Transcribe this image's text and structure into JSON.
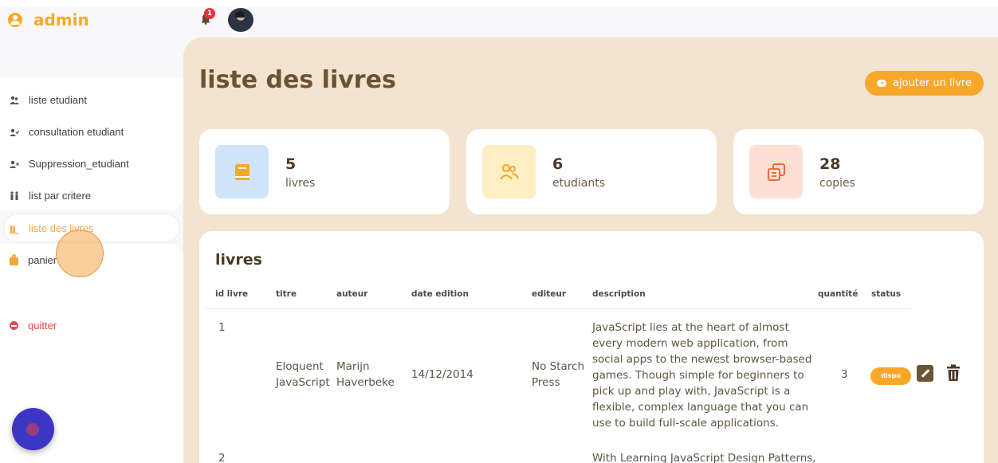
{
  "brand": {
    "title": "admin"
  },
  "topbar": {
    "notification_count": "1"
  },
  "sidebar": {
    "items": [
      {
        "label": "liste etudiant",
        "icon": "user-group-icon"
      },
      {
        "label": "consultation etudiant",
        "icon": "user-check-icon"
      },
      {
        "label": "Suppression_etudiant",
        "icon": "user-remove-icon"
      },
      {
        "label": "list par critere",
        "icon": "people-icon"
      },
      {
        "label": "liste des livres",
        "icon": "books-icon",
        "active": true
      },
      {
        "label": "panier",
        "icon": "bag-icon"
      },
      {
        "label": "quitter",
        "icon": "quit-icon"
      }
    ]
  },
  "main": {
    "title": "liste des livres",
    "add_button": "ajouter un livre",
    "stats": [
      {
        "value": "5",
        "label": "livres",
        "color": "#cfe4f8",
        "icon_color": "#f7a82a"
      },
      {
        "value": "6",
        "label": "etudiants",
        "color": "#fdefc2",
        "icon_color": "#f7a82a"
      },
      {
        "value": "28",
        "label": "copies",
        "color": "#fde0d4",
        "icon_color": "#ef6a3a"
      }
    ],
    "table": {
      "title": "livres",
      "headers": [
        "id livre",
        "titre",
        "auteur",
        "date edition",
        "editeur",
        "description",
        "quantité",
        "status"
      ],
      "rows": [
        {
          "id": "1",
          "titre": "Eloquent JavaScript",
          "auteur": "Marijn Haverbeke",
          "date": "14/12/2014",
          "editeur": "No Starch Press",
          "description": "JavaScript lies at the heart of almost every modern web application, from social apps to the newest browser-based games. Though simple for beginners to pick up and play with, JavaScript is a flexible, complex language that you can use to build full-scale applications.",
          "quantite": "3",
          "status": "dispo"
        },
        {
          "id": "2",
          "description": "With Learning JavaScript Design Patterns,"
        }
      ]
    }
  },
  "colors": {
    "accent": "#f7a82a",
    "main_bg": "#f2e4cf",
    "title": "#6a5232",
    "danger": "#e24b5b"
  }
}
